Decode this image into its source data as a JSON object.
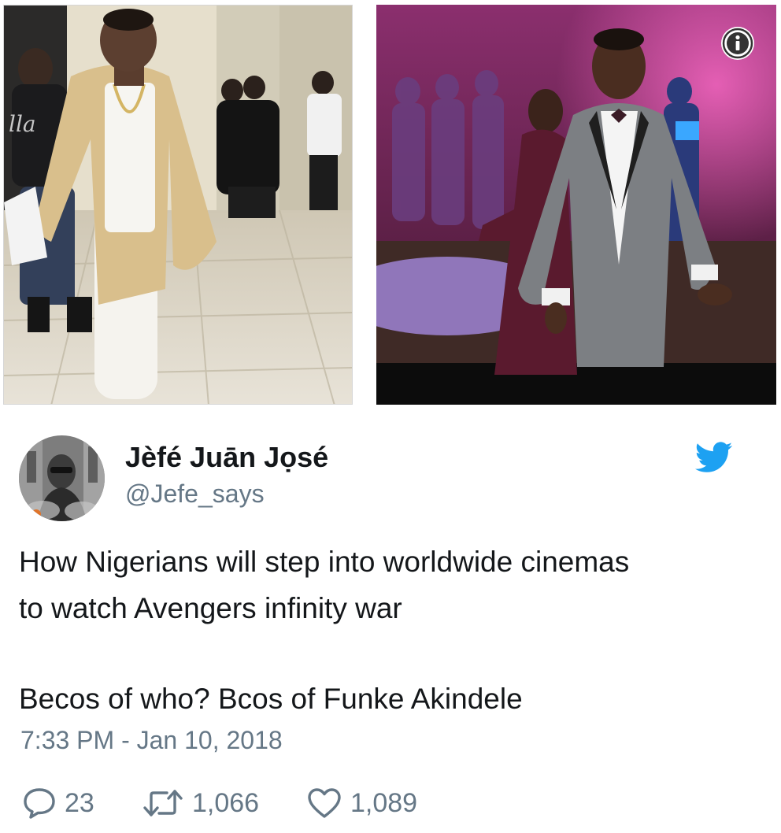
{
  "tweet": {
    "display_name": "Jèfé Juān Jọsé",
    "handle": "@Jefe_says",
    "text_line1": "How Nigerians will step into worldwide cinemas",
    "text_line2": "to watch Avengers infinity war",
    "text_line3": "Becos of who? Bcos of Funke Akindele",
    "timestamp": "7:33 PM - Jan 10, 2018"
  },
  "media": {
    "left_photo_icon": "photo-man-in-beige-coat",
    "right_photo_icon": "photo-man-in-grey-suit-dancing",
    "info_icon": "info-icon",
    "left_watermark": "lla"
  },
  "actions": {
    "reply_count": "23",
    "retweet_count": "1,066",
    "like_count": "1,089"
  },
  "colors": {
    "twitter_blue": "#1da1f2",
    "secondary_text": "#657786",
    "primary_text": "#14171a"
  }
}
